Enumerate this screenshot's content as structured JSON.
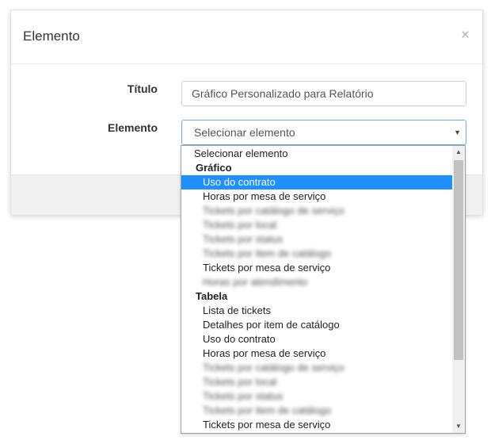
{
  "modal": {
    "title": "Elemento",
    "close_label": "×",
    "fields": {
      "title_label": "Título",
      "title_value": "Gráfico Personalizado para Relatório",
      "element_label": "Elemento",
      "element_selected": "Selecionar elemento",
      "caret": "▼"
    }
  },
  "dropdown": {
    "scroll_up": "▲",
    "scroll_down": "▼",
    "rows": [
      {
        "kind": "placeholder",
        "label": "Selecionar elemento"
      },
      {
        "kind": "group",
        "label": "Gráfico"
      },
      {
        "kind": "option",
        "label": "Uso do contrato",
        "selected": true
      },
      {
        "kind": "option",
        "label": "Horas por mesa de serviço"
      },
      {
        "kind": "option",
        "label": "Tickets por catálogo de serviço",
        "blurred": true
      },
      {
        "kind": "option",
        "label": "Tickets por local",
        "blurred": true
      },
      {
        "kind": "option",
        "label": "Tickets por status",
        "blurred": true
      },
      {
        "kind": "option",
        "label": "Tickets por item de catálogo",
        "blurred": true
      },
      {
        "kind": "option",
        "label": "Tickets por mesa de serviço"
      },
      {
        "kind": "option",
        "label": "Horas por atendimento",
        "blurred": true
      },
      {
        "kind": "group",
        "label": "Tabela"
      },
      {
        "kind": "option",
        "label": "Lista de tickets"
      },
      {
        "kind": "option",
        "label": "Detalhes por item de catálogo"
      },
      {
        "kind": "option",
        "label": "Uso do contrato"
      },
      {
        "kind": "option",
        "label": "Horas por mesa de serviço"
      },
      {
        "kind": "option",
        "label": "Tickets por catálogo de serviço",
        "blurred": true
      },
      {
        "kind": "option",
        "label": "Tickets por local",
        "blurred": true
      },
      {
        "kind": "option",
        "label": "Tickets por status",
        "blurred": true
      },
      {
        "kind": "option",
        "label": "Tickets por item de catálogo",
        "blurred": true
      },
      {
        "kind": "option",
        "label": "Tickets por mesa de serviço"
      }
    ]
  }
}
